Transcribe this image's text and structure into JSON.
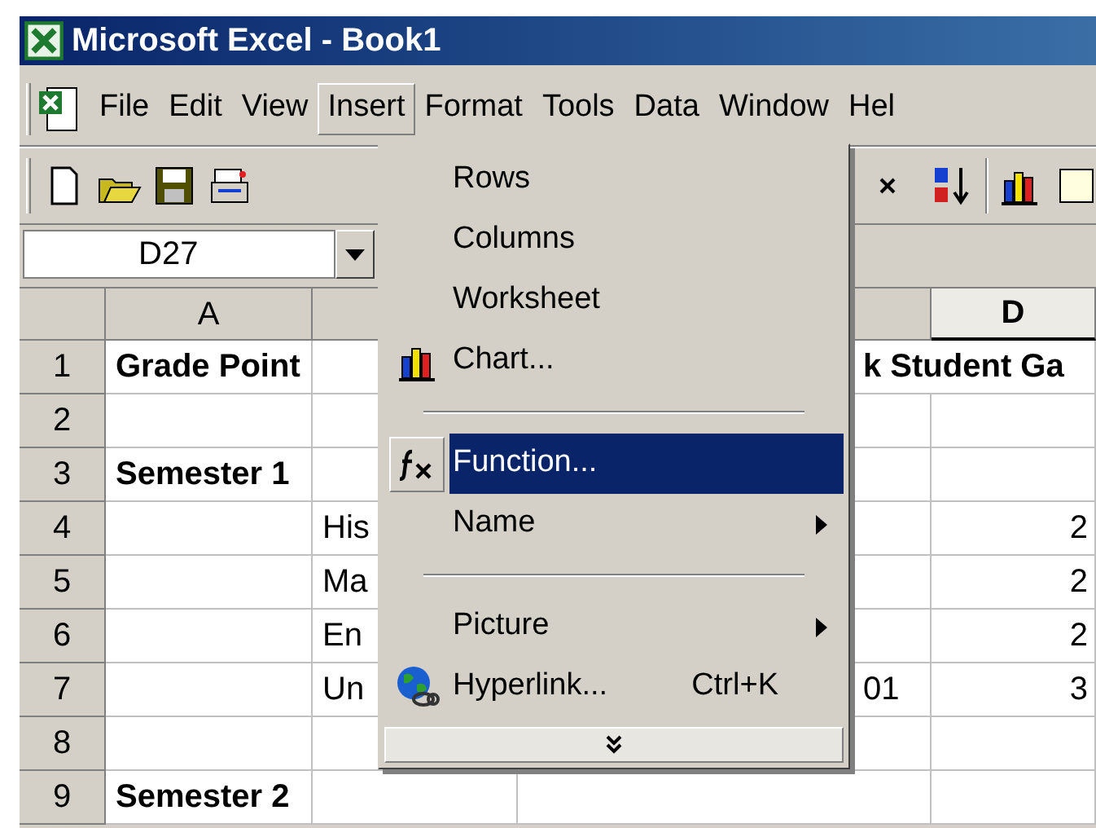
{
  "window": {
    "title": "Microsoft Excel - Book1"
  },
  "menu_bar": [
    {
      "label": "File",
      "selected": false
    },
    {
      "label": "Edit",
      "selected": false
    },
    {
      "label": "View",
      "selected": false
    },
    {
      "label": "Insert",
      "selected": true
    },
    {
      "label": "Format",
      "selected": false
    },
    {
      "label": "Tools",
      "selected": false
    },
    {
      "label": "Data",
      "selected": false
    },
    {
      "label": "Window",
      "selected": false
    },
    {
      "label": "Hel",
      "selected": false
    }
  ],
  "name_box": {
    "value": "D27"
  },
  "columns": [
    {
      "label": "A",
      "selected": false
    },
    {
      "selected": false
    },
    {
      "selected": false
    },
    {
      "label": "D",
      "selected": true
    }
  ],
  "rows": [
    {
      "number": "1",
      "a": "Grade Point",
      "c": "k Student Ga"
    },
    {
      "number": "2"
    },
    {
      "number": "3",
      "a": "Semester 1"
    },
    {
      "number": "4",
      "b": "His",
      "d": "2"
    },
    {
      "number": "5",
      "b": "Ma",
      "d": "2"
    },
    {
      "number": "6",
      "b": "En",
      "d": "2"
    },
    {
      "number": "7",
      "b": "Un",
      "c": "01",
      "d": "3"
    },
    {
      "number": "8"
    },
    {
      "number": "9",
      "a": "Semester 2"
    }
  ],
  "insert_menu": [
    {
      "kind": "item",
      "label": "Rows",
      "submenu": false,
      "selected": false
    },
    {
      "kind": "item",
      "label": "Columns",
      "submenu": false,
      "selected": false
    },
    {
      "kind": "item",
      "label": "Worksheet",
      "submenu": false,
      "selected": false
    },
    {
      "kind": "item",
      "label": "Chart...",
      "submenu": false,
      "selected": false
    },
    {
      "kind": "separator"
    },
    {
      "kind": "item",
      "label": "Function...",
      "submenu": false,
      "selected": true
    },
    {
      "kind": "item",
      "label": "Name",
      "submenu": true,
      "selected": false
    },
    {
      "kind": "separator"
    },
    {
      "kind": "item",
      "label": "Picture",
      "submenu": true,
      "selected": false
    },
    {
      "kind": "item",
      "label": "Hyperlink...",
      "shortcut": "Ctrl+K",
      "submenu": false,
      "selected": false
    },
    {
      "kind": "more"
    }
  ]
}
